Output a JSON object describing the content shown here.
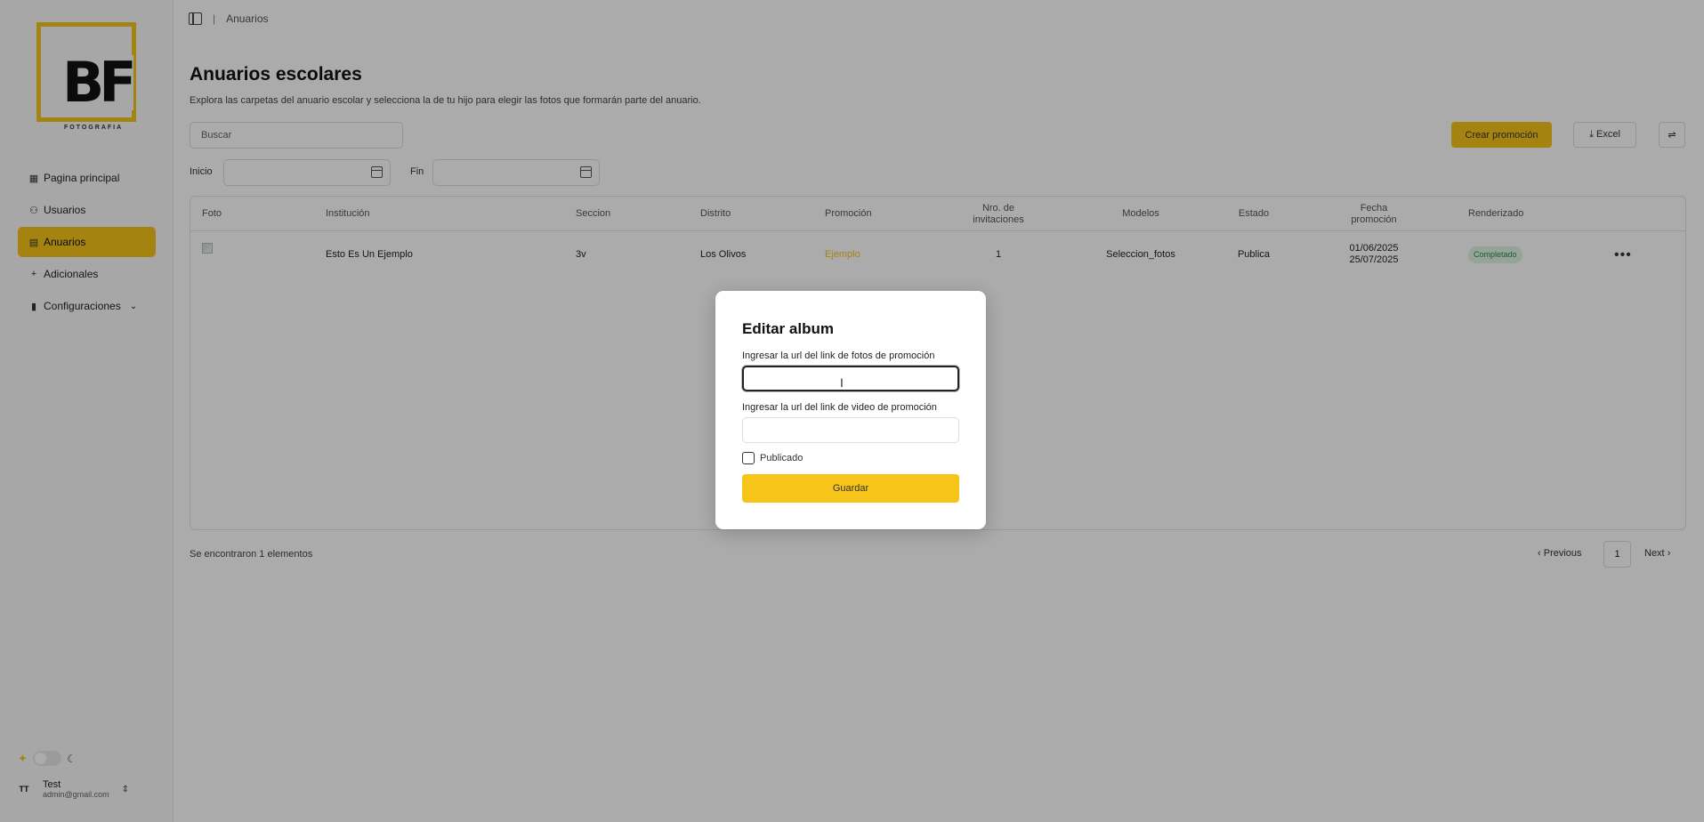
{
  "brand": {
    "mark": "BF",
    "subtitle": "FOTOGRAFIA",
    "accent_color": "#f7c419"
  },
  "sidebar": {
    "items": [
      {
        "label": "Pagina principal",
        "icon": "dashboard-icon"
      },
      {
        "label": "Usuarios",
        "icon": "users-icon"
      },
      {
        "label": "Anuarios",
        "icon": "book-icon",
        "active": true
      },
      {
        "label": "Adicionales",
        "icon": "plus-icon"
      },
      {
        "label": "Configuraciones",
        "icon": "chart-icon",
        "has_submenu": true
      }
    ],
    "user": {
      "initials": "TT",
      "name": "Test",
      "email": "admin@gmail.com"
    }
  },
  "breadcrumb": {
    "current": "Anuarios"
  },
  "page": {
    "title": "Anuarios escolares",
    "description": "Explora las carpetas del anuario escolar y selecciona la de tu hijo para elegir las fotos que formarán parte del anuario."
  },
  "toolbar": {
    "search_placeholder": "Buscar",
    "create_label": "Crear promoción",
    "excel_label": "Excel",
    "start_label": "Inicio",
    "end_label": "Fin"
  },
  "table": {
    "headers": {
      "foto": "Foto",
      "institucion": "Institución",
      "seccion": "Seccion",
      "distrito": "Distrito",
      "promocion": "Promoción",
      "invitaciones": "Nro. de\ninvitaciones",
      "modelos": "Modelos",
      "estado": "Estado",
      "fecha": "Fecha\npromoción",
      "renderizado": "Renderizado"
    },
    "rows": [
      {
        "institucion": "Esto Es Un Ejemplo",
        "seccion": "3v",
        "distrito": "Los Olivos",
        "promocion": "Ejemplo",
        "invitaciones": "1",
        "modelos": "Seleccion_fotos",
        "estado": "Publica",
        "fecha": "01/06/2025\n25/07/2025",
        "renderizado": "Completado"
      }
    ]
  },
  "footer": {
    "found_text": "Se encontraron 1 elementos",
    "previous_label": "Previous",
    "page": "1",
    "next_label": "Next"
  },
  "modal": {
    "title": "Editar album",
    "photos_label": "Ingresar la url del link de fotos de promoción",
    "video_label": "Ingresar la url del link de video de promoción",
    "photos_value": "",
    "video_value": "",
    "published_label": "Publicado",
    "published": false,
    "save_label": "Guardar"
  }
}
